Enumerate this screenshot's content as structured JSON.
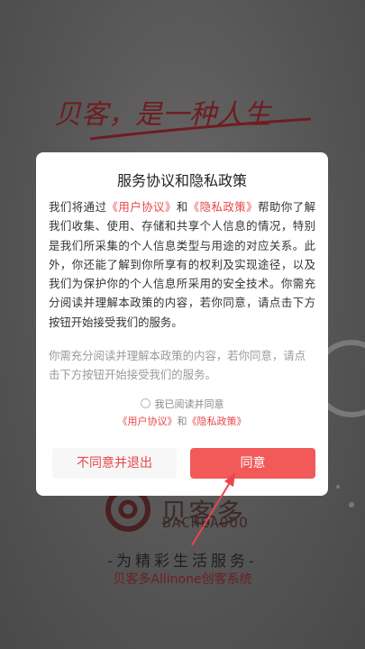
{
  "splash": {
    "slogan": "贝客，是一种人生",
    "brand_cn": "贝客多",
    "brand_en": "BACHEAOOO",
    "tagline": "-为精彩生活服务-",
    "subtag": "贝客多Allinone创客系统"
  },
  "dialog": {
    "title": "服务协议和隐私政策",
    "body_pre": "我们将通过",
    "user_agreement_link": "《用户协议》",
    "and": "和",
    "privacy_policy_link": "《隐私政策》",
    "body_post": "帮助你了解我们收集、使用、存储和共享个人信息的情况，特别是我们所采集的个人信息类型与用途的对应关系。此外，你还能了解到你所享有的权利及实现途径，以及我们为保护你的个人信息所采用的安全技术。你需充分阅读并理解本政策的内容，若你同意，请点击下方按钮开始接受我们的服务。",
    "note": "你需充分阅读并理解本政策的内容，若你同意，请点击下方按钮开始接受我们的服务。",
    "checkbox_label": "我已阅读并同意",
    "agree_user_link": "《用户协议》",
    "agree_and": "和",
    "agree_privacy_link": "《隐私政策》",
    "reject_button": "不同意并退出",
    "agree_button": "同意"
  },
  "colors": {
    "accent": "#e8474a",
    "agree_bg": "#f25a5a",
    "overlay": "#5a5959"
  }
}
